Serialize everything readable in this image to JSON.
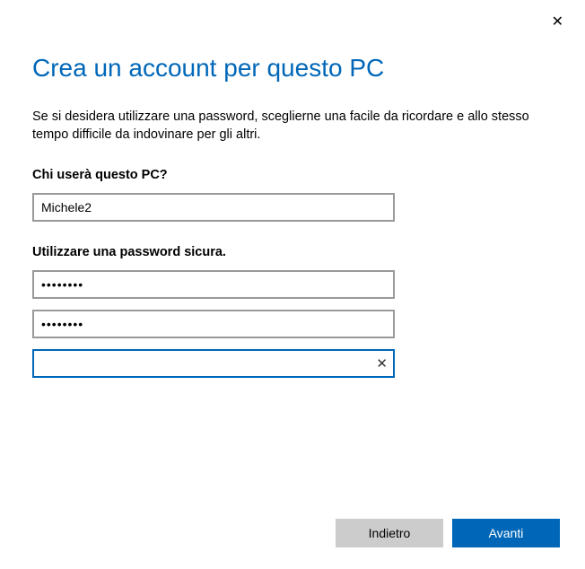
{
  "title": "Crea un account per questo PC",
  "description": "Se si desidera utilizzare una password, sceglierne una facile da ricordare e allo stesso tempo difficile da indovinare per gli altri.",
  "user_section": {
    "label": "Chi userà questo PC?",
    "username_value": "Michele2"
  },
  "password_section": {
    "label": "Utilizzare una password sicura.",
    "password_value": "••••••••",
    "confirm_value": "••••••••",
    "hint_value": ""
  },
  "buttons": {
    "back": "Indietro",
    "next": "Avanti"
  }
}
